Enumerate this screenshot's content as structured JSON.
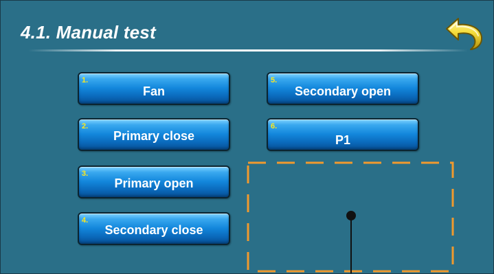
{
  "header": {
    "title": "4.1. Manual test"
  },
  "buttons": [
    {
      "number": "1.",
      "label": "Fan"
    },
    {
      "number": "2.",
      "label": "Primary close"
    },
    {
      "number": "3.",
      "label": "Primary open"
    },
    {
      "number": "4.",
      "label": "Secondary close"
    },
    {
      "number": "5.",
      "label": "Secondary open"
    },
    {
      "number": "6.",
      "label": "P1"
    }
  ],
  "icons": {
    "back": "back-arrow-icon",
    "probe": "probe-sensor-icon"
  },
  "colors": {
    "background": "#2a6f88",
    "button_blue": "#1387dc",
    "number_yellow": "#ffe81a",
    "dashed_orange": "#f09a2e",
    "back_arrow_yellow": "#f4dc3a"
  }
}
